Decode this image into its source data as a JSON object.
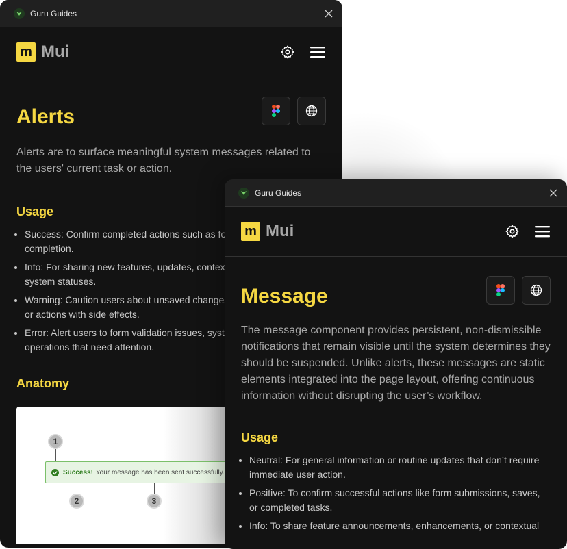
{
  "colors": {
    "accent": "#f5d742",
    "window_bg": "#131313",
    "success": "#2f7d1f"
  },
  "window_back": {
    "titlebar": {
      "title": "Guru Guides"
    },
    "header": {
      "brand": "Mui",
      "brand_logo": "m"
    },
    "page": {
      "title": "Alerts",
      "lead": "Alerts are to surface meaningful system messages related to the users' current task or action.",
      "usage_heading": "Usage",
      "usage_items": [
        "Success: Confirm completed actions such as form saves, or task completion.",
        "Info: For sharing new features, updates, contextual tips, or non-urgent system statuses.",
        "Warning: Caution users about unsaved changes, deprecated features, or actions with side effects.",
        "Error: Alert users to form validation issues, system failures, or operations that need attention."
      ],
      "anatomy_heading": "Anatomy",
      "anatomy": {
        "alert_bold": "Success!",
        "alert_text": "Your message has been sent successfully.",
        "markers": [
          "1",
          "2",
          "3"
        ]
      }
    }
  },
  "window_front": {
    "titlebar": {
      "title": "Guru Guides"
    },
    "header": {
      "brand": "Mui",
      "brand_logo": "m"
    },
    "page": {
      "title": "Message",
      "lead": "The message component provides persistent, non-dismissible notifications that remain visible until the system determines they should be suspended. Unlike alerts, these messages are static elements integrated into the page layout, offering continuous information without disrupting the user’s workflow.",
      "usage_heading": "Usage",
      "usage_items": [
        "Neutral: For general information or routine updates that don’t require immediate user action.",
        "Positive: To confirm successful actions like form submissions, saves, or completed tasks.",
        "Info: To share feature announcements, enhancements, or contextual"
      ]
    }
  },
  "icons": [
    "guru-logo-icon",
    "close-icon",
    "settings-gear-icon",
    "hamburger-menu-icon",
    "figma-icon",
    "globe-icon",
    "check-circle-icon"
  ]
}
